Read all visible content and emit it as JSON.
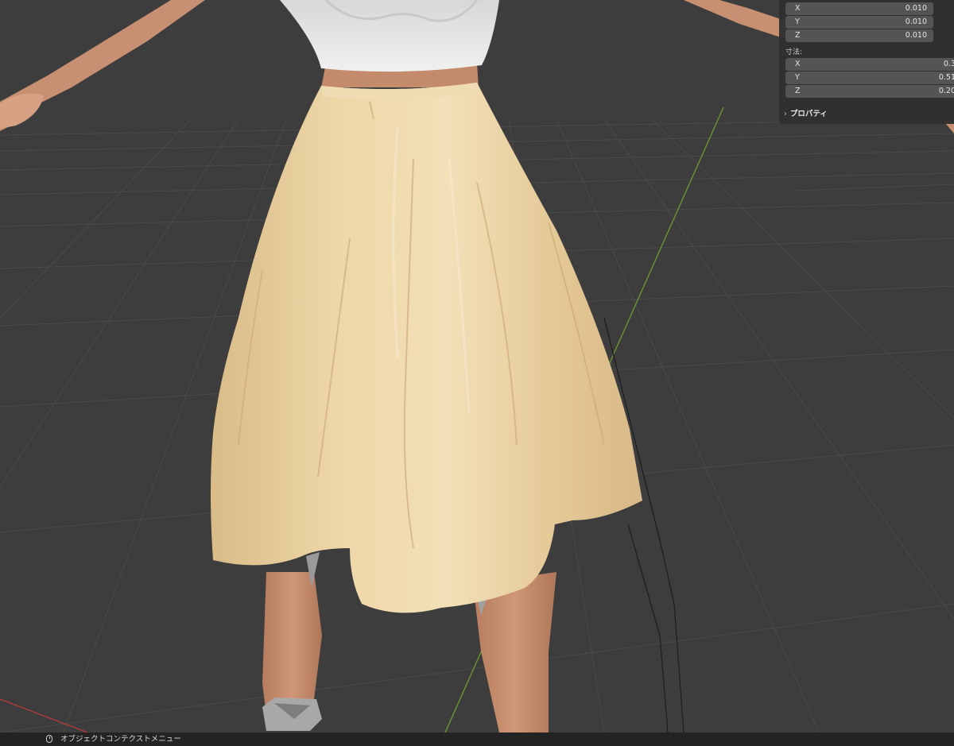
{
  "sidebar": {
    "scale_rows": [
      {
        "axis": "X",
        "value": "0.010"
      },
      {
        "axis": "Y",
        "value": "0.010"
      },
      {
        "axis": "Z",
        "value": "0.010"
      }
    ],
    "dimensions_label": "寸法:",
    "dimension_rows": [
      {
        "axis": "X",
        "value": "0.3"
      },
      {
        "axis": "Y",
        "value": "0.51"
      },
      {
        "axis": "Z",
        "value": "0.20"
      }
    ],
    "properties_label": "プロパティ"
  },
  "statusbar": {
    "hint": "オブジェクトコンテクストメニュー"
  },
  "colors": {
    "viewport_bg": "#3d3d3d",
    "skirt": "#e8cf9e",
    "skin": "#c48a6c",
    "top": "#e9e9e9",
    "y_axis_green": "#6e9a2e",
    "x_axis_red": "#b83a3a"
  }
}
